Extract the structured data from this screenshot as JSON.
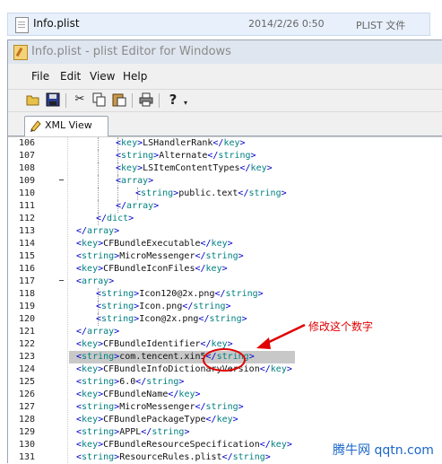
{
  "explorer": {
    "file_name": "Info.plist",
    "modified": "2014/2/26 0:50",
    "file_type": "PLIST 文件"
  },
  "window": {
    "title": "Info.plist - plist Editor for Windows"
  },
  "menu": [
    "File",
    "Edit",
    "View",
    "Help"
  ],
  "toolbar_icons": [
    "open-folder-icon",
    "save-icon",
    "cut-icon",
    "copy-icon",
    "paste-icon",
    "print-icon",
    "help-icon",
    "dropdown-icon"
  ],
  "tab": {
    "label": "XML View"
  },
  "code_lines": [
    {
      "n": "106",
      "indent": 3,
      "k": "key",
      "v": "LSHandlerRank"
    },
    {
      "n": "107",
      "indent": 3,
      "k": "string",
      "v": "Alternate"
    },
    {
      "n": "108",
      "indent": 3,
      "k": "key",
      "v": "LSItemContentTypes"
    },
    {
      "n": "109",
      "indent": 3,
      "open": "array"
    },
    {
      "n": "110",
      "indent": 4,
      "k": "string",
      "v": "public.text"
    },
    {
      "n": "111",
      "indent": 3,
      "close": "array"
    },
    {
      "n": "112",
      "indent": 2,
      "close": "dict"
    },
    {
      "n": "113",
      "indent": 1,
      "close": "array"
    },
    {
      "n": "114",
      "indent": 1,
      "k": "key",
      "v": "CFBundleExecutable"
    },
    {
      "n": "115",
      "indent": 1,
      "k": "string",
      "v": "MicroMessenger"
    },
    {
      "n": "116",
      "indent": 1,
      "k": "key",
      "v": "CFBundleIconFiles"
    },
    {
      "n": "117",
      "indent": 1,
      "open": "array"
    },
    {
      "n": "118",
      "indent": 2,
      "k": "string",
      "v": "Icon120@2x.png"
    },
    {
      "n": "119",
      "indent": 2,
      "k": "string",
      "v": "Icon.png"
    },
    {
      "n": "120",
      "indent": 2,
      "k": "string",
      "v": "Icon@2x.png"
    },
    {
      "n": "121",
      "indent": 1,
      "close": "array"
    },
    {
      "n": "122",
      "indent": 1,
      "k": "key",
      "v": "CFBundleIdentifier"
    },
    {
      "n": "123",
      "indent": 1,
      "k": "string",
      "v": "com.tencent.xin5"
    },
    {
      "n": "124",
      "indent": 1,
      "k": "key",
      "v": "CFBundleInfoDictionaryVersion"
    },
    {
      "n": "125",
      "indent": 1,
      "k": "string",
      "v": "6.0"
    },
    {
      "n": "126",
      "indent": 1,
      "k": "key",
      "v": "CFBundleName"
    },
    {
      "n": "127",
      "indent": 1,
      "k": "string",
      "v": "MicroMessenger"
    },
    {
      "n": "128",
      "indent": 1,
      "k": "key",
      "v": "CFBundlePackageType"
    },
    {
      "n": "129",
      "indent": 1,
      "k": "string",
      "v": "APPL"
    },
    {
      "n": "130",
      "indent": 1,
      "k": "key",
      "v": "CFBundleResourceSpecification"
    },
    {
      "n": "131",
      "indent": 1,
      "k": "string",
      "v": "ResourceRules.plist"
    }
  ],
  "annotation": {
    "note": "修改这个数字"
  },
  "watermark": {
    "text": "腾牛网 qqtn.com"
  },
  "colors": {
    "tag": "#008080",
    "bracket": "#0000cc",
    "annotation": "#e00000",
    "selection": "#c8c8c8"
  }
}
